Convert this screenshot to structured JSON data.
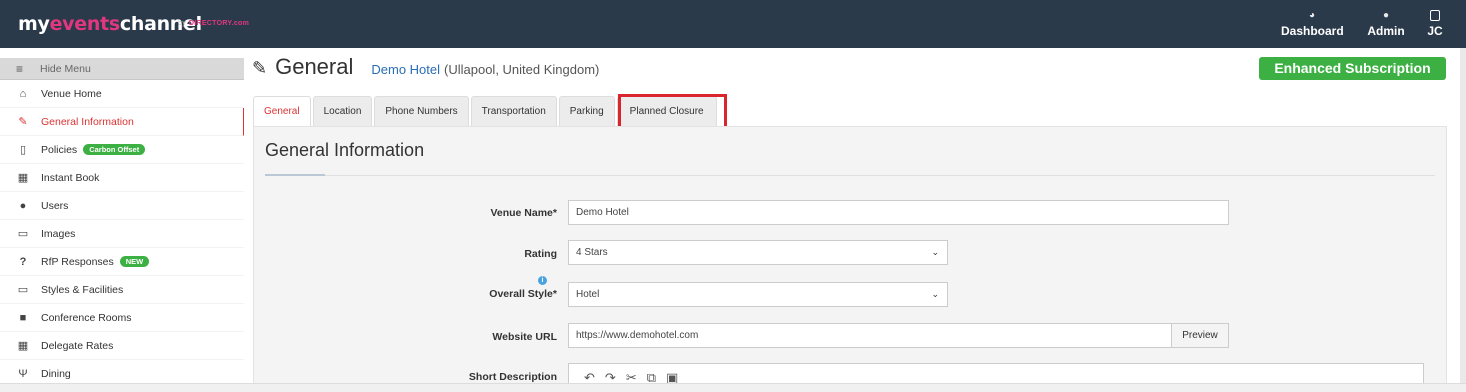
{
  "topbar": {
    "logo_prefix": "my",
    "logo_accent": "events",
    "logo_suffix": "channel",
    "logo_by": "by",
    "logo_vd": "DIRECTORY.com",
    "nav": [
      {
        "label": "Dashboard",
        "icon": "dashboard-icon"
      },
      {
        "label": "Admin",
        "icon": "user-icon"
      },
      {
        "label": "JC",
        "icon": "profile-icon"
      }
    ]
  },
  "sidebar": {
    "hide_menu": "Hide Menu",
    "items": [
      {
        "label": "Venue Home",
        "icon": "home-icon"
      },
      {
        "label": "General Information",
        "icon": "edit-icon",
        "active": true
      },
      {
        "label": "Policies",
        "icon": "document-icon",
        "badge": "Carbon Offset"
      },
      {
        "label": "Instant Book",
        "icon": "calendar-icon"
      },
      {
        "label": "Users",
        "icon": "user-icon"
      },
      {
        "label": "Images",
        "icon": "image-icon"
      },
      {
        "label": "RfP Responses",
        "icon": "question-icon",
        "badge": "NEW"
      },
      {
        "label": "Styles & Facilities",
        "icon": "monitor-icon"
      },
      {
        "label": "Conference Rooms",
        "icon": "briefcase-icon"
      },
      {
        "label": "Delegate Rates",
        "icon": "calculator-icon"
      },
      {
        "label": "Dining",
        "icon": "dining-icon"
      }
    ]
  },
  "header": {
    "title": "General",
    "venue_name": "Demo Hotel",
    "venue_location": "(Ullapool, United Kingdom)",
    "subscription": "Enhanced Subscription"
  },
  "tabs": [
    {
      "label": "General",
      "active": true
    },
    {
      "label": "Location"
    },
    {
      "label": "Phone Numbers"
    },
    {
      "label": "Transportation"
    },
    {
      "label": "Parking"
    },
    {
      "label": "Planned Closure"
    }
  ],
  "form": {
    "section_title": "General Information",
    "venue_name_label": "Venue Name",
    "venue_name_value": "Demo Hotel",
    "rating_label": "Rating",
    "rating_value": "4 Stars",
    "overall_style_label": "Overall Style",
    "overall_style_value": "Hotel",
    "website_label": "Website URL",
    "website_value": "https://www.demohotel.com",
    "preview_label": "Preview",
    "short_desc_label": "Short Description",
    "required_marker": "*"
  },
  "colors": {
    "navbar": "#2b3a4a",
    "accent_pink": "#e0377f",
    "active_red": "#dd3333",
    "subscription_green": "#3cb043",
    "highlight_red": "#d9252c"
  }
}
